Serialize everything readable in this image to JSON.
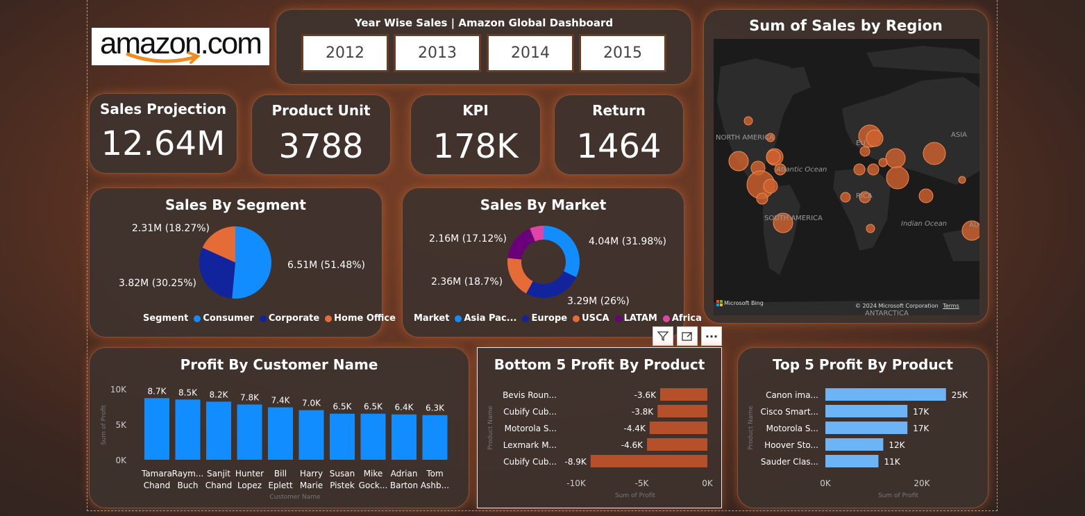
{
  "logo": {
    "text": "amazon.com"
  },
  "year_filter": {
    "title": "Year Wise Sales | Amazon Global Dashboard",
    "years": [
      "2012",
      "2013",
      "2014",
      "2015"
    ]
  },
  "kpis": [
    {
      "label": "Sales Projection",
      "value": "12.64M"
    },
    {
      "label": "Product Unit",
      "value": "3788"
    },
    {
      "label": "KPI",
      "value": "178K"
    },
    {
      "label": "Return",
      "value": "1464"
    }
  ],
  "segment_chart": {
    "title": "Sales By Segment",
    "legend_title": "Segment",
    "slice_labels": [
      "6.51M (51.48%)",
      "3.82M (30.25%)",
      "2.31M (18.27%)"
    ],
    "legend": [
      "Consumer",
      "Corporate",
      "Home Office"
    ]
  },
  "market_chart": {
    "title": "Sales By Market",
    "legend_title": "Market",
    "slice_labels": [
      "4.04M (31.98%)",
      "3.29M (26%)",
      "2.36M (18.7%)",
      "2.16M (17.12%)"
    ],
    "legend": [
      "Asia Pac...",
      "Europe",
      "USCA",
      "LATAM",
      "Africa"
    ]
  },
  "region_map": {
    "title": "Sum of Sales by Region",
    "labels": [
      "NORTH AMERICA",
      "Atlantic Ocean",
      "SOUTH AMERICA",
      "ASIA",
      "EU",
      "RICA",
      "Indian Ocean",
      "AU",
      "ANTARCTICA"
    ],
    "attribution": "Microsoft Bing",
    "copyright": "© 2024 Microsoft Corporation",
    "terms": "Terms"
  },
  "customer_chart": {
    "title": "Profit By Customer Name",
    "xlabel": "Customer Name",
    "ylabel": "Sum of Profit",
    "yticks": [
      "10K",
      "5K",
      "0K"
    ],
    "data_labels": [
      "8.7K",
      "8.5K",
      "8.2K",
      "7.8K",
      "7.4K",
      "7.0K",
      "6.5K",
      "6.5K",
      "6.4K",
      "6.3K"
    ],
    "names": [
      [
        "Tamara",
        "Chand"
      ],
      [
        "Raym...",
        "Buch"
      ],
      [
        "Sanjit",
        "Chand"
      ],
      [
        "Hunter",
        "Lopez"
      ],
      [
        "Bill",
        "Eplett"
      ],
      [
        "Harry",
        "Marie"
      ],
      [
        "Susan",
        "Pistek"
      ],
      [
        "Mike",
        "Gock..."
      ],
      [
        "Adrian",
        "Barton"
      ],
      [
        "Tom",
        "Ashb..."
      ]
    ]
  },
  "bottom_chart": {
    "title": "Bottom 5 Profit By Product",
    "xlabel": "Sum of Profit",
    "ylabel": "Product Name",
    "xticks": [
      "-10K",
      "-5K",
      "0K"
    ],
    "data_labels": [
      "-3.6K",
      "-3.8K",
      "-4.4K",
      "-4.6K",
      "-8.9K"
    ],
    "products": [
      "Bevis Roun...",
      "Cubify Cub...",
      "Motorola S...",
      "Lexmark M...",
      "Cubify Cub..."
    ]
  },
  "top_chart": {
    "title": "Top 5 Profit By Product",
    "xlabel": "Sum of Profit",
    "ylabel": "Product Name",
    "xticks": [
      "0K",
      "20K"
    ],
    "data_labels": [
      "25K",
      "17K",
      "17K",
      "12K",
      "11K"
    ],
    "products": [
      "Canon ima...",
      "Cisco Smart...",
      "Motorola S...",
      "Hoover Sto...",
      "Sauder Clas..."
    ]
  },
  "toolbar": {
    "more": "···"
  },
  "colors": {
    "consumer": "#118dff",
    "corporate": "#12239e",
    "home_office": "#e66c37",
    "asia_pac": "#118dff",
    "europe": "#12239e",
    "usca": "#e66c37",
    "latam": "#6b007b",
    "africa": "#e044a7",
    "bottom_bar": "#b5502b",
    "top_bar": "#6cb4f5",
    "customer_bar": "#118dff",
    "bubble": "#d0612f"
  },
  "chart_data": [
    {
      "type": "pie",
      "title": "Sales By Segment",
      "categories": [
        "Consumer",
        "Corporate",
        "Home Office"
      ],
      "values": [
        6.51,
        3.82,
        2.31
      ],
      "percent": [
        51.48,
        30.25,
        18.27
      ],
      "unit": "M"
    },
    {
      "type": "pie",
      "title": "Sales By Market",
      "categories": [
        "Asia Pacific",
        "Europe",
        "USCA",
        "LATAM",
        "Africa"
      ],
      "values": [
        4.04,
        3.29,
        2.36,
        2.16,
        0.79
      ],
      "percent": [
        31.98,
        26,
        18.7,
        17.12,
        6.2
      ],
      "unit": "M"
    },
    {
      "type": "bar",
      "title": "Profit By Customer Name",
      "categories": [
        "Tamara Chand",
        "Raymond Buch",
        "Sanjit Chand",
        "Hunter Lopez",
        "Bill Eplett",
        "Harry Marie",
        "Susan Pistek",
        "Mike Gockenbach",
        "Adrian Barton",
        "Tom Ashbrook"
      ],
      "values": [
        8.7,
        8.5,
        8.2,
        7.8,
        7.4,
        7.0,
        6.5,
        6.5,
        6.4,
        6.3
      ],
      "unit": "K",
      "ylim": [
        0,
        10
      ]
    },
    {
      "type": "bar",
      "title": "Bottom 5 Profit By Product",
      "categories": [
        "Bevis Roun...",
        "Cubify Cub...",
        "Motorola S...",
        "Lexmark M...",
        "Cubify Cub..."
      ],
      "values": [
        -3.6,
        -3.8,
        -4.4,
        -4.6,
        -8.9
      ],
      "unit": "K",
      "xlim": [
        -10,
        0
      ]
    },
    {
      "type": "bar",
      "title": "Top 5 Profit By Product",
      "categories": [
        "Canon ima...",
        "Cisco Smart...",
        "Motorola S...",
        "Hoover Sto...",
        "Sauder Clas..."
      ],
      "values": [
        25,
        17,
        17,
        12,
        11
      ],
      "unit": "K",
      "xlim": [
        0,
        25
      ]
    }
  ]
}
